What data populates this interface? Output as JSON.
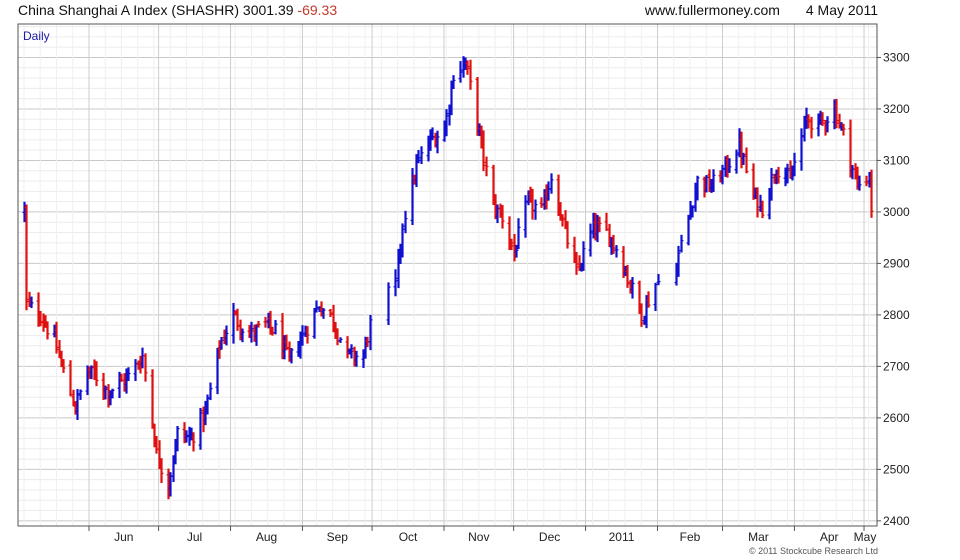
{
  "header": {
    "title": "China Shanghai A Index (SHASHR)",
    "last_price": "3001.39",
    "change": "-69.33",
    "site": "www.fullermoney.com",
    "date": "4 May 2011"
  },
  "footer": {
    "copyright": "© 2011 Stockcube Research Ltd"
  },
  "colors": {
    "up": "#1010d0",
    "down": "#e01010",
    "change_text": "#c0392b",
    "grid": "#cfcfcf",
    "frame": "#555555"
  },
  "chart_data": {
    "type": "ohlc",
    "period_label": "Daily",
    "x_tick_labels": [
      "Jun",
      "Jul",
      "Aug",
      "Sep",
      "Oct",
      "Nov",
      "Dec",
      "2011",
      "Feb",
      "Mar",
      "Apr",
      "May"
    ],
    "y_ticks": [
      2400,
      2500,
      2600,
      2700,
      2800,
      2900,
      3000,
      3100,
      3200,
      3300
    ],
    "ylim": [
      2390,
      3365
    ],
    "y_axis_side": "right",
    "grid": true,
    "date_range": [
      "2010-05-04",
      "2011-05-04"
    ],
    "series": [
      {
        "closes": [
          [
            "2010-05-05",
            2820
          ],
          [
            "2010-05-11",
            2800
          ],
          [
            "2010-05-17",
            2750
          ],
          [
            "2010-05-21",
            2690
          ],
          [
            "2010-05-26",
            2620
          ],
          [
            "2010-05-31",
            2690
          ],
          [
            "2010-06-04",
            2680
          ],
          [
            "2010-06-09",
            2650
          ],
          [
            "2010-06-18",
            2680
          ],
          [
            "2010-06-24",
            2720
          ],
          [
            "2010-06-30",
            2530
          ],
          [
            "2010-07-05",
            2470
          ],
          [
            "2010-07-09",
            2570
          ],
          [
            "2010-07-15",
            2560
          ],
          [
            "2010-07-21",
            2610
          ],
          [
            "2010-07-27",
            2740
          ],
          [
            "2010-08-02",
            2800
          ],
          [
            "2010-08-09",
            2760
          ],
          [
            "2010-08-16",
            2780
          ],
          [
            "2010-08-20",
            2770
          ],
          [
            "2010-08-26",
            2710
          ],
          [
            "2010-09-01",
            2760
          ],
          [
            "2010-09-08",
            2820
          ],
          [
            "2010-09-14",
            2790
          ],
          [
            "2010-09-20",
            2720
          ],
          [
            "2010-09-27",
            2720
          ],
          [
            "2010-09-30",
            2780
          ],
          [
            "2010-10-11",
            2860
          ],
          [
            "2010-10-14",
            2980
          ],
          [
            "2010-10-20",
            3090
          ],
          [
            "2010-10-26",
            3140
          ],
          [
            "2010-11-01",
            3160
          ],
          [
            "2010-11-05",
            3270
          ],
          [
            "2010-11-10",
            3290
          ],
          [
            "2010-11-16",
            3150
          ],
          [
            "2010-11-22",
            3010
          ],
          [
            "2010-11-26",
            2990
          ],
          [
            "2010-12-01",
            2920
          ],
          [
            "2010-12-07",
            3020
          ],
          [
            "2010-12-13",
            3000
          ],
          [
            "2010-12-17",
            3070
          ],
          [
            "2010-12-23",
            2960
          ],
          [
            "2010-12-28",
            2880
          ],
          [
            "2011-01-04",
            2970
          ],
          [
            "2011-01-10",
            2960
          ],
          [
            "2011-01-14",
            2930
          ],
          [
            "2011-01-20",
            2860
          ],
          [
            "2011-01-25",
            2800
          ],
          [
            "2011-01-31",
            2860
          ],
          [
            "2011-02-09",
            2900
          ],
          [
            "2011-02-14",
            2990
          ],
          [
            "2011-02-18",
            3060
          ],
          [
            "2011-02-24",
            3050
          ],
          [
            "2011-03-03",
            3090
          ],
          [
            "2011-03-08",
            3130
          ],
          [
            "2011-03-14",
            3030
          ],
          [
            "2011-03-18",
            3010
          ],
          [
            "2011-03-24",
            3090
          ],
          [
            "2011-03-30",
            3060
          ],
          [
            "2011-04-06",
            3180
          ],
          [
            "2011-04-12",
            3170
          ],
          [
            "2011-04-18",
            3200
          ],
          [
            "2011-04-22",
            3150
          ],
          [
            "2011-04-28",
            3050
          ],
          [
            "2011-05-03",
            3070
          ],
          [
            "2011-05-04",
            3001.39
          ]
        ]
      }
    ]
  }
}
